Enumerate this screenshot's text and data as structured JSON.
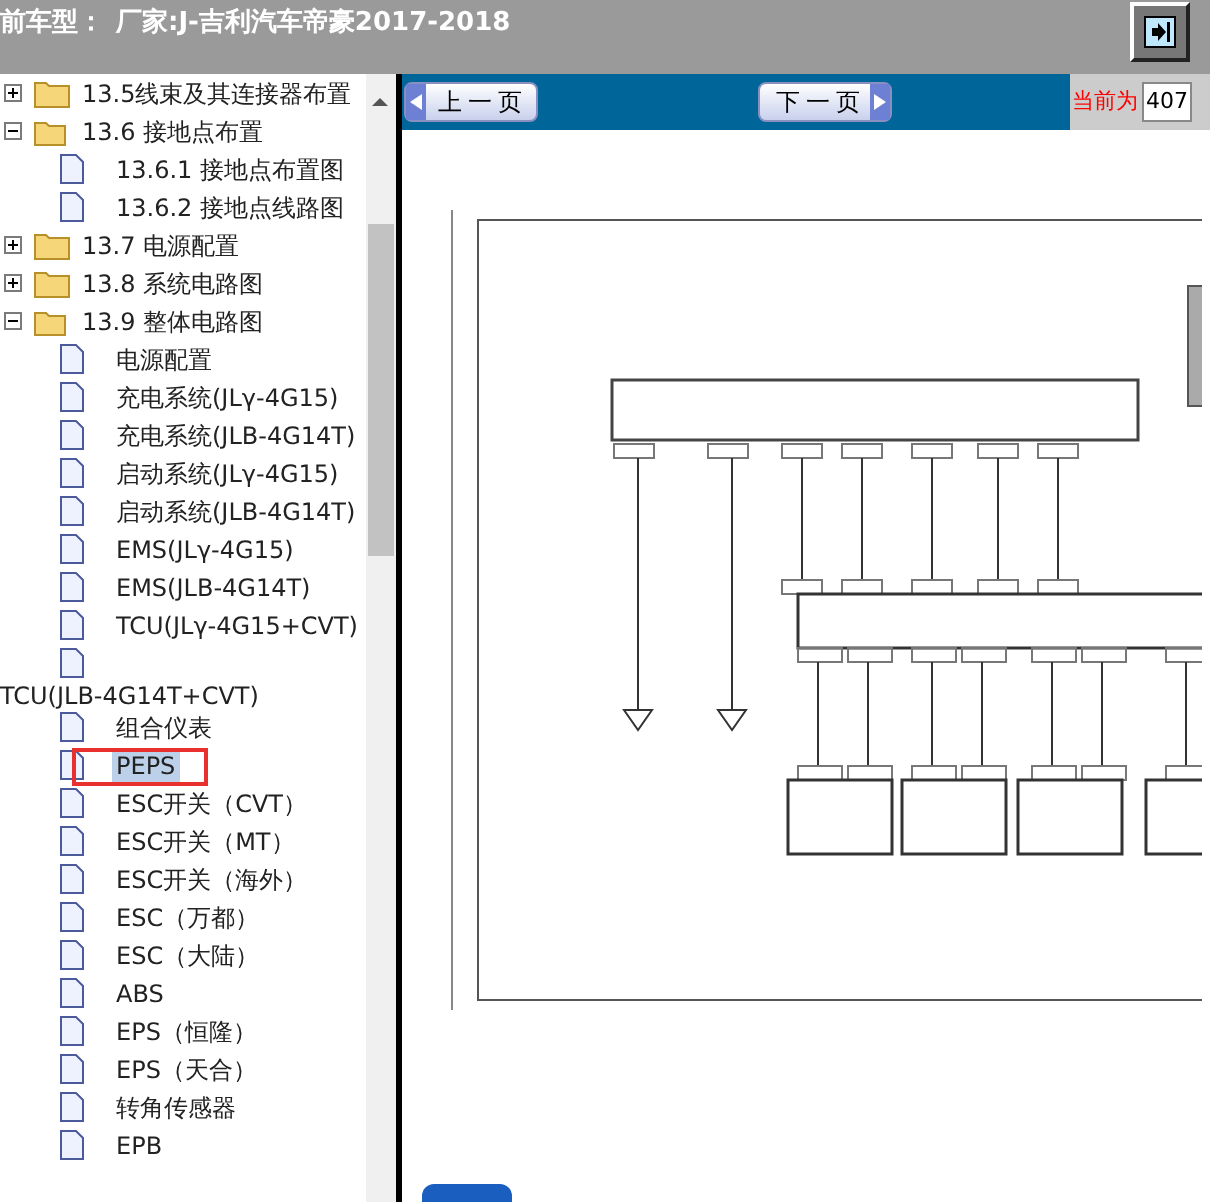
{
  "header": {
    "label": "前车型：",
    "value": "厂家:J-吉利汽车帝豪2017-2018"
  },
  "tree": [
    {
      "label": "13.5线束及其连接器布置",
      "kind": "folder",
      "expanded": false,
      "selected": false
    },
    {
      "label": "13.6 接地点布置",
      "kind": "folder",
      "expanded": true,
      "selected": false,
      "children": [
        {
          "label": "13.6.1 接地点布置图",
          "kind": "page",
          "selected": false
        },
        {
          "label": "13.6.2 接地点线路图",
          "kind": "page",
          "selected": false
        }
      ]
    },
    {
      "label": "13.7 电源配置",
      "kind": "folder",
      "expanded": false,
      "selected": false
    },
    {
      "label": "13.8 系统电路图",
      "kind": "folder",
      "expanded": false,
      "selected": false
    },
    {
      "label": "13.9 整体电路图",
      "kind": "folder",
      "expanded": true,
      "selected": false,
      "children": [
        {
          "label": "电源配置",
          "kind": "page",
          "selected": false
        },
        {
          "label": "充电系统(JLγ-4G15)",
          "kind": "page",
          "selected": false
        },
        {
          "label": "充电系统(JLB-4G14T)",
          "kind": "page",
          "selected": false
        },
        {
          "label": "启动系统(JLγ-4G15)",
          "kind": "page",
          "selected": false
        },
        {
          "label": "启动系统(JLB-4G14T)",
          "kind": "page",
          "selected": false
        },
        {
          "label": "EMS(JLγ-4G15)",
          "kind": "page",
          "selected": false
        },
        {
          "label": "EMS(JLB-4G14T)",
          "kind": "page",
          "selected": false
        },
        {
          "label": "TCU(JLγ-4G15+CVT)",
          "kind": "page",
          "selected": false
        },
        {
          "label": "TCU(JLB-4G14T+CVT)",
          "kind": "wrapped",
          "selected": false
        },
        {
          "label": "组合仪表",
          "kind": "page",
          "selected": false
        },
        {
          "label": "PEPS",
          "kind": "page",
          "selected": true
        },
        {
          "label": "ESC开关（CVT）",
          "kind": "page",
          "selected": false
        },
        {
          "label": "ESC开关（MT）",
          "kind": "page",
          "selected": false
        },
        {
          "label": "ESC开关（海外）",
          "kind": "page",
          "selected": false
        },
        {
          "label": "ESC（万都）",
          "kind": "page",
          "selected": false
        },
        {
          "label": "ESC（大陆）",
          "kind": "page",
          "selected": false
        },
        {
          "label": "ABS",
          "kind": "page",
          "selected": false
        },
        {
          "label": "EPS（恒隆）",
          "kind": "page",
          "selected": false
        },
        {
          "label": "EPS（天合）",
          "kind": "page",
          "selected": false
        },
        {
          "label": "转角传感器",
          "kind": "page",
          "selected": false
        },
        {
          "label": "EPB",
          "kind": "page",
          "selected": false
        }
      ]
    }
  ],
  "toolbar": {
    "prev": "上一页",
    "next": "下一页",
    "page_label": "当前为",
    "page_value": "407"
  }
}
